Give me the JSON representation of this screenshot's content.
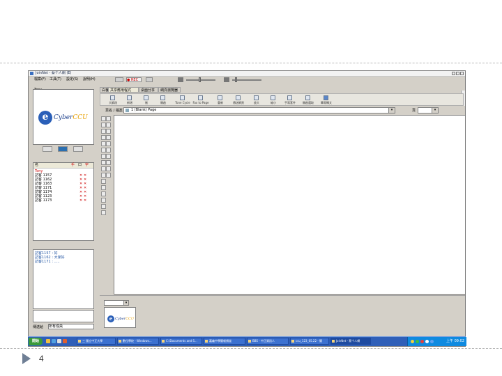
{
  "slide": {
    "page_number": "4"
  },
  "window": {
    "title": "JoinNet - 蔡个人網 (E)",
    "menus": [
      "檔案(F)",
      "工具(T)",
      "設定(S)",
      "說明(H)"
    ]
  },
  "toolbar": {
    "rec_label": "● REC"
  },
  "left_panel": {
    "logo_group_label": "Tony",
    "logo": {
      "letter": "e",
      "name_main": "Cyber",
      "name_accent": "CCU"
    },
    "contacts_header": [
      "名",
      "手",
      "口",
      "字"
    ],
    "contacts": [
      {
        "name": "Tony",
        "highlight": true
      },
      {
        "name": "訪客 1157"
      },
      {
        "name": "訪客 1162"
      },
      {
        "name": "訪客 1163"
      },
      {
        "name": "訪客 1171"
      },
      {
        "name": "訪客 1174"
      },
      {
        "name": "訪客 1123"
      },
      {
        "name": "訪客 1173"
      }
    ],
    "messages": [
      "訪客1157 : 好",
      "訪客1162 : 大家好",
      "訪客1171 : ....."
    ],
    "send_label": "傳送給",
    "send_value": "所有成員"
  },
  "tabs": [
    "白板",
    "共享應用程式",
    "桌面分享",
    "網頁瀏覽器"
  ],
  "tools": [
    "大綱改",
    "新增",
    "刪",
    "開啟",
    "Tone Cycle",
    "Fax to Page",
    "重新",
    "傳送網頁",
    "放大",
    "縮小",
    "手寫套件",
    "開啟選取",
    "筆寫轉文"
  ],
  "url_bar": {
    "label": "頁名 / 檔案",
    "value": "1 (Blank) Page",
    "page_label": "頁"
  },
  "thumb_logo": {
    "letter": "e",
    "name_main": "Cyber",
    "name_accent": "CCU"
  },
  "taskbar": {
    "start_label": "開始",
    "tasks": [
      "三 國立中正大學",
      "數位學校 - Windows...",
      "C:\\Documents and S...",
      "嘉義中學簡報頻道",
      "BBS - 中正資訊人",
      "ccu_123_05.22 - 簡",
      "JoinNet - 蔡个人網"
    ],
    "clock": "上午 09:02"
  }
}
